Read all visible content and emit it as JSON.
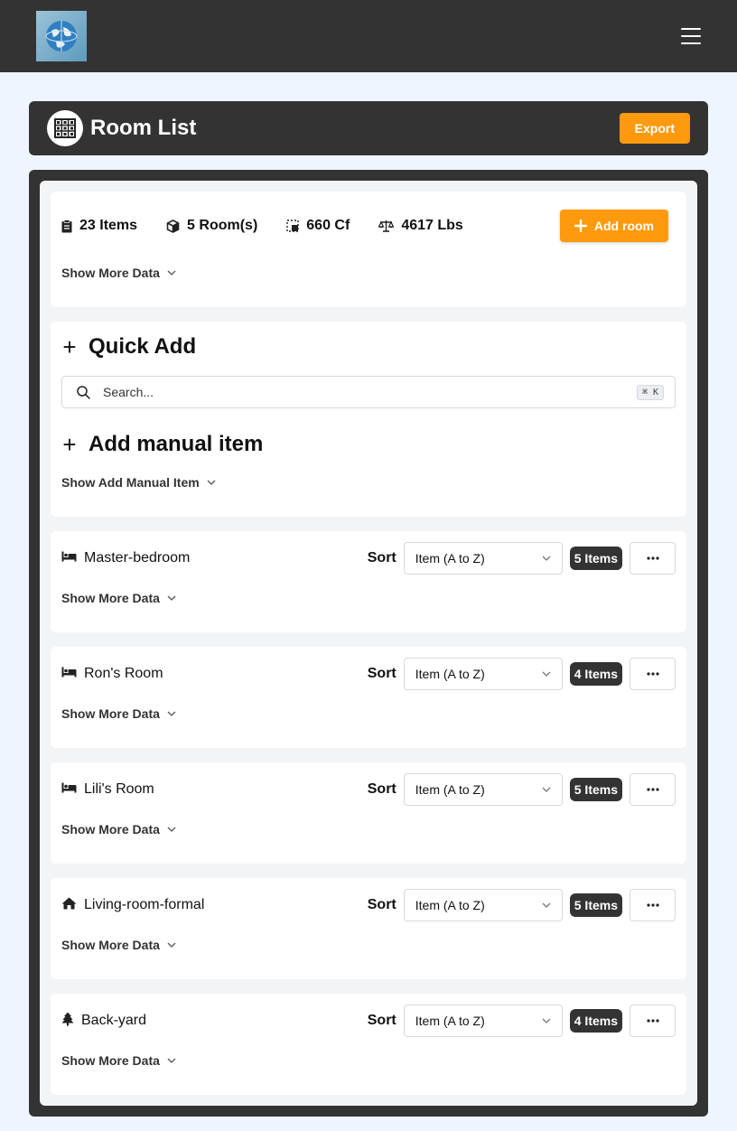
{
  "header": {
    "logo_icon": "globe-logo-icon",
    "menu_icon": "hamburger-icon"
  },
  "title_bar": {
    "title": "Room List",
    "export_label": "Export"
  },
  "stats": {
    "items": "23 Items",
    "rooms": "5 Room(s)",
    "volume": "660 Cf",
    "weight": "4617 Lbs",
    "add_room_label": "Add room",
    "show_more_label": "Show More Data"
  },
  "quick_add": {
    "title": "Quick Add",
    "search_placeholder": "Search...",
    "shortcut": "⌘ K",
    "manual_title": "Add manual item",
    "show_manual_label": "Show Add Manual Item"
  },
  "rooms": [
    {
      "name": "Master-bedroom",
      "icon": "bed-icon",
      "sort_label": "Sort",
      "sort_value": "Item (A to Z)",
      "count": "5 Items",
      "show_more": "Show More Data"
    },
    {
      "name": "Ron's Room",
      "icon": "bed-icon",
      "sort_label": "Sort",
      "sort_value": "Item (A to Z)",
      "count": "4 Items",
      "show_more": "Show More Data"
    },
    {
      "name": "Lili's Room",
      "icon": "bed-icon",
      "sort_label": "Sort",
      "sort_value": "Item (A to Z)",
      "count": "5 Items",
      "show_more": "Show More Data"
    },
    {
      "name": "Living-room-formal",
      "icon": "house-icon",
      "sort_label": "Sort",
      "sort_value": "Item (A to Z)",
      "count": "5 Items",
      "show_more": "Show More Data"
    },
    {
      "name": "Back-yard",
      "icon": "tree-icon",
      "sort_label": "Sort",
      "sort_value": "Item (A to Z)",
      "count": "4 Items",
      "show_more": "Show More Data"
    }
  ],
  "colors": {
    "accent": "#ff9a0f",
    "dark": "#333333",
    "page_bg": "#eff5ff"
  }
}
